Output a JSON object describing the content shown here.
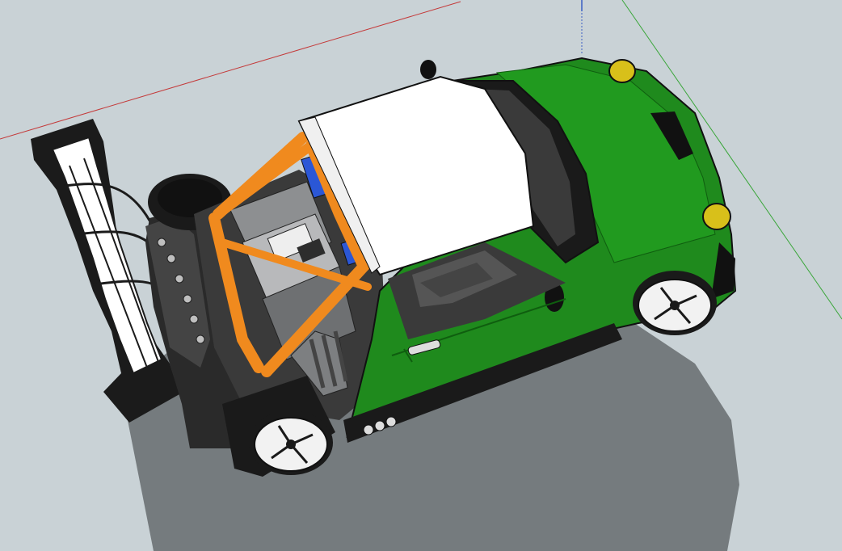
{
  "app": {
    "name": "",
    "view": "3d-model-viewport"
  },
  "scene": {
    "model": "race-car",
    "colors": {
      "sky": "#c9d2d6",
      "shadow": "#757b7e",
      "body_green": "#1f8a1d",
      "body_green_dark": "#0f5e0f",
      "roof_white": "#ffffff",
      "roll_cage_orange": "#f08a1e",
      "tire_black": "#1a1a1a",
      "rim_white": "#f2f2f2",
      "headlight_yellow": "#d8c01a",
      "red_axis": "#c43a3a",
      "green_axis": "#3aa63a",
      "blue_axis": "#3a5fc4",
      "engine_grey": "#8d8f91",
      "battery_blue": "#2b57d6"
    },
    "icons": [
      "red-axis-line",
      "green-axis-line",
      "blue-axis-line"
    ]
  }
}
